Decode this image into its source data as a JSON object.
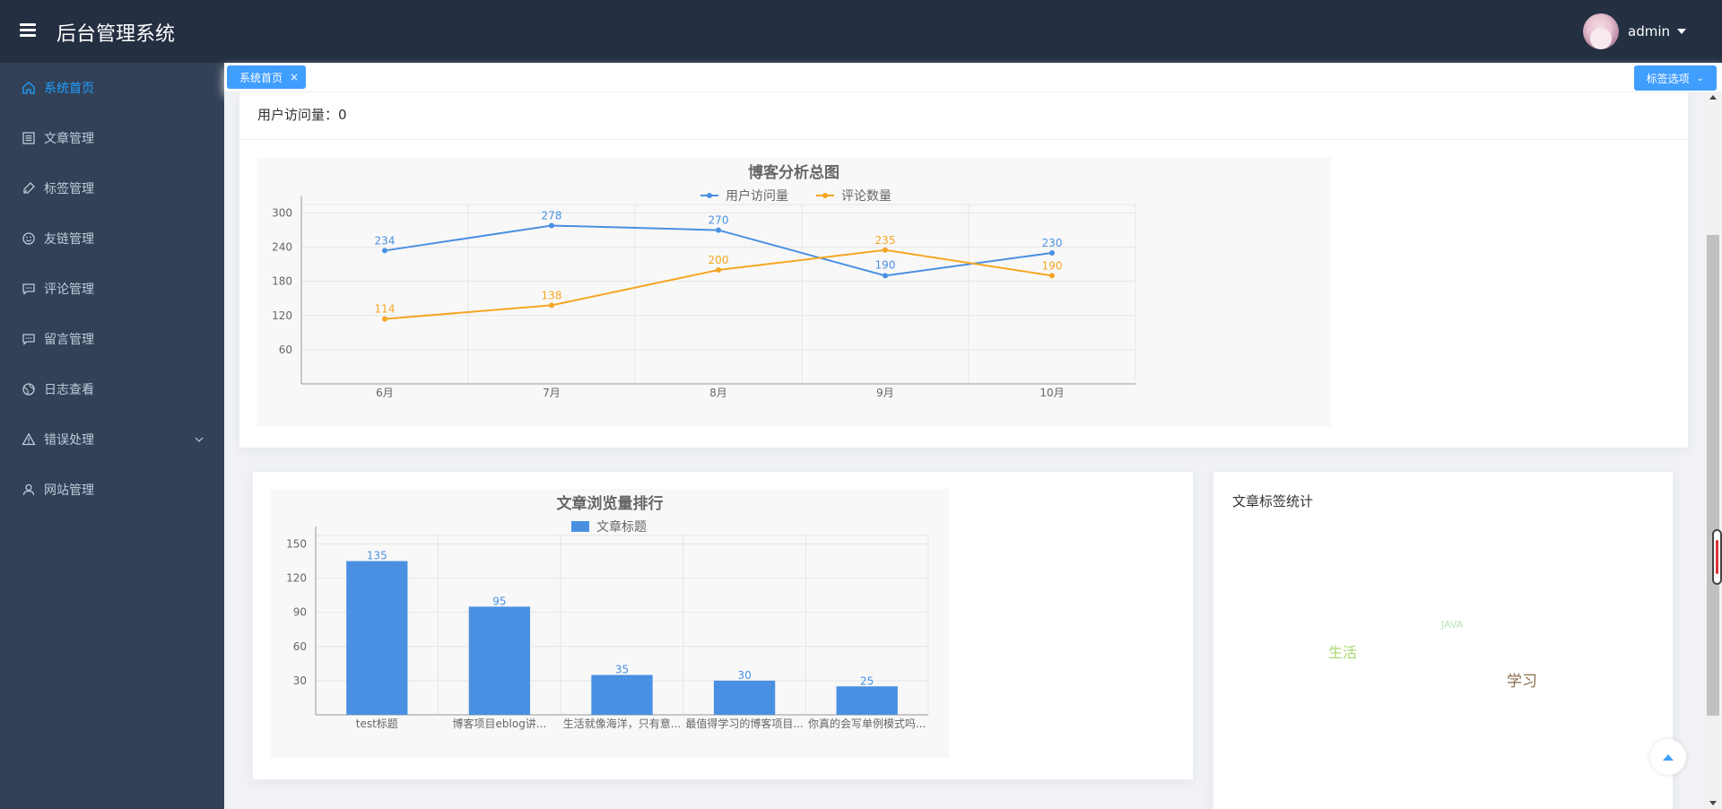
{
  "header": {
    "title": "后台管理系统",
    "username": "admin"
  },
  "sidebar": {
    "items": [
      {
        "label": "系统首页",
        "icon": "home-icon"
      },
      {
        "label": "文章管理",
        "icon": "document-icon"
      },
      {
        "label": "标签管理",
        "icon": "tag-icon"
      },
      {
        "label": "友链管理",
        "icon": "smile-icon"
      },
      {
        "label": "评论管理",
        "icon": "comment-icon"
      },
      {
        "label": "留言管理",
        "icon": "message-icon"
      },
      {
        "label": "日志查看",
        "icon": "globe-icon"
      },
      {
        "label": "错误处理",
        "icon": "warning-icon"
      },
      {
        "label": "网站管理",
        "icon": "user-icon"
      }
    ]
  },
  "tags": {
    "active_tag": "系统首页",
    "close_glyph": "×",
    "options_label": "标签选项"
  },
  "dashboard": {
    "visits_label": "用户访问量：0",
    "tag_stats_title": "文章标签统计",
    "word_cloud": [
      {
        "text": "JAVA",
        "color": "#b8e6b8"
      },
      {
        "text": "生活",
        "color": "#a6d96a"
      },
      {
        "text": "学习",
        "color": "#8c6d4f"
      }
    ]
  },
  "colors": {
    "accent": "#409eff",
    "sidebar_bg": "#324157",
    "header_bg": "#242f42",
    "series_blue": "#4a90e2",
    "series_orange": "#f5a623"
  },
  "chart_data": [
    {
      "type": "line",
      "title": "博客分析总图",
      "categories": [
        "6月",
        "7月",
        "8月",
        "9月",
        "10月"
      ],
      "series": [
        {
          "name": "用户访问量",
          "values": [
            234,
            278,
            270,
            190,
            230
          ],
          "color": "#4a90e2"
        },
        {
          "name": "评论数量",
          "values": [
            114,
            138,
            200,
            235,
            190
          ],
          "color": "#f5a623"
        }
      ],
      "y_ticks": [
        60,
        120,
        180,
        240,
        300
      ],
      "ylim": [
        0,
        315
      ],
      "grid": true,
      "legend": "top-center"
    },
    {
      "type": "bar",
      "title": "文章浏览量排行",
      "categories": [
        "test标题",
        "博客项目eblog讲...",
        "生活就像海洋，只有意...",
        "最值得学习的博客项目...",
        "你真的会写单例模式吗..."
      ],
      "series": [
        {
          "name": "文章标题",
          "values": [
            135,
            95,
            35,
            30,
            25
          ],
          "color": "#4a90e2"
        }
      ],
      "y_ticks": [
        30,
        60,
        90,
        120,
        150
      ],
      "ylim": [
        0,
        157.5
      ],
      "grid": true,
      "legend": "top-center"
    }
  ]
}
